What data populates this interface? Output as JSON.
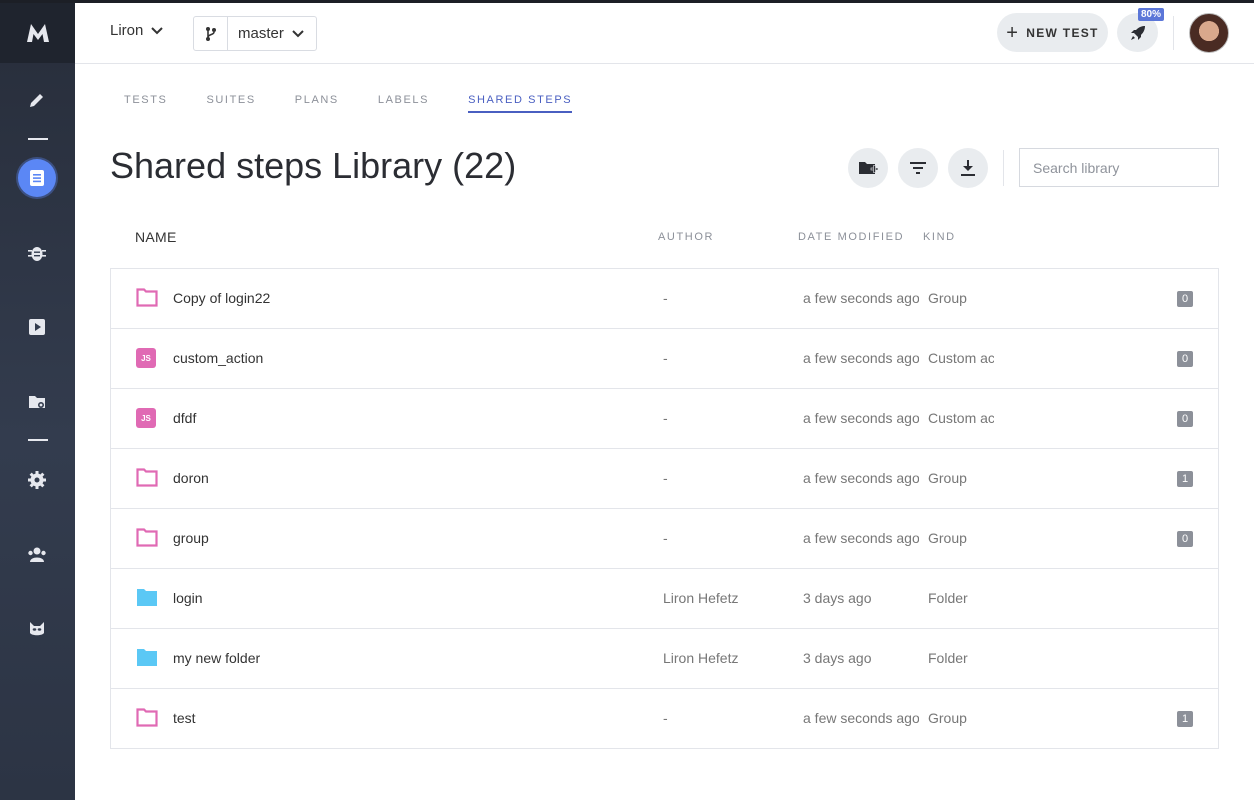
{
  "header": {
    "user": "Liron",
    "branch": "master",
    "new_test_label": "NEW TEST",
    "progress_badge": "80%"
  },
  "tabs": [
    {
      "label": "TESTS",
      "active": false
    },
    {
      "label": "SUITES",
      "active": false
    },
    {
      "label": "PLANS",
      "active": false
    },
    {
      "label": "LABELS",
      "active": false
    },
    {
      "label": "SHARED STEPS",
      "active": true
    }
  ],
  "page": {
    "title": "Shared steps Library (22)",
    "search_placeholder": "Search library"
  },
  "columns": {
    "name": "NAME",
    "author": "AUTHOR",
    "date_modified": "DATE MODIFIED",
    "kind": "KIND"
  },
  "rows": [
    {
      "icon": "group-folder-icon",
      "name": "Copy of login22",
      "author": "-",
      "date": "a few seconds ago",
      "kind": "Group",
      "count": "0"
    },
    {
      "icon": "js-icon",
      "name": "custom_action",
      "author": "-",
      "date": "a few seconds ago",
      "kind": "Custom action",
      "count": "0"
    },
    {
      "icon": "js-icon",
      "name": "dfdf",
      "author": "-",
      "date": "a few seconds ago",
      "kind": "Custom action",
      "count": "0"
    },
    {
      "icon": "group-folder-icon",
      "name": "doron",
      "author": "-",
      "date": "a few seconds ago",
      "kind": "Group",
      "count": "1"
    },
    {
      "icon": "group-folder-icon",
      "name": "group",
      "author": "-",
      "date": "a few seconds ago",
      "kind": "Group",
      "count": "0"
    },
    {
      "icon": "folder-icon",
      "name": "login",
      "author": "Liron Hefetz",
      "date": "3 days ago",
      "kind": "Folder",
      "count": ""
    },
    {
      "icon": "folder-icon",
      "name": "my new folder",
      "author": "Liron Hefetz",
      "date": "3 days ago",
      "kind": "Folder",
      "count": ""
    },
    {
      "icon": "group-folder-icon",
      "name": "test",
      "author": "-",
      "date": "a few seconds ago",
      "kind": "Group",
      "count": "1"
    }
  ],
  "colors": {
    "accent": "#4a5fc1",
    "sidebar_active": "#5b87f5",
    "group_icon": "#e06ab4",
    "folder_icon": "#5bc8f5"
  }
}
